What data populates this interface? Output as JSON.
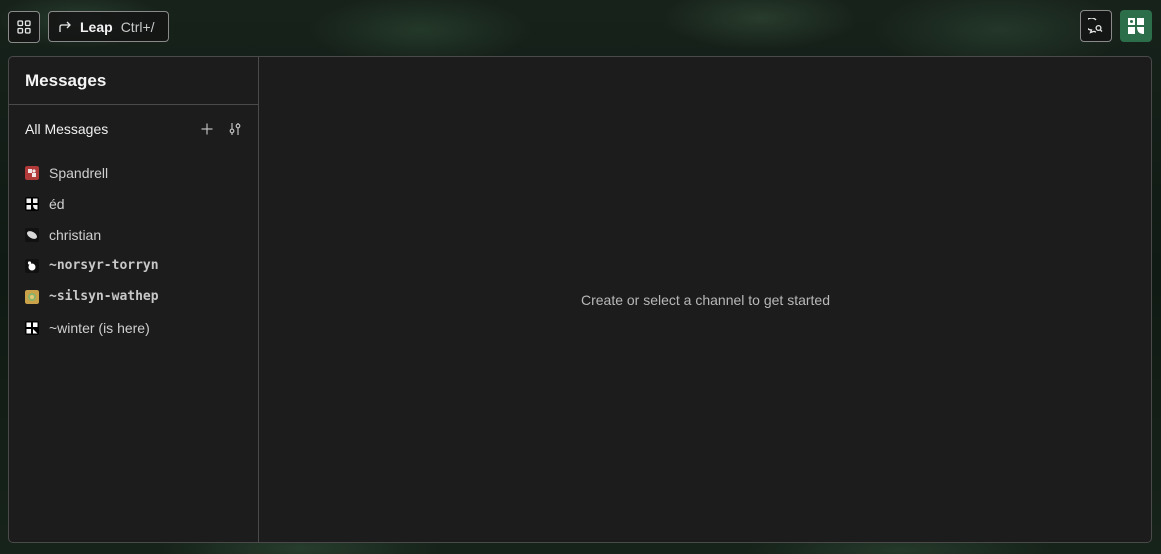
{
  "topbar": {
    "apps_icon": "grid-icon",
    "leap_label": "Leap",
    "leap_shortcut": "Ctrl+/",
    "notifications_icon": "search-chat-icon"
  },
  "sidebar": {
    "title": "Messages",
    "section_title": "All Messages",
    "channels": [
      {
        "name": "Spandrell",
        "mono": false,
        "color": "#b03a3a"
      },
      {
        "name": "éd",
        "mono": false,
        "color": "#f2f2f2"
      },
      {
        "name": "christian",
        "mono": false,
        "color": "#d8d8d8"
      },
      {
        "name": "~norsyr-torryn",
        "mono": true,
        "color": "#ffffff"
      },
      {
        "name": "~silsyn-wathep",
        "mono": true,
        "color": "#c9a24a"
      },
      {
        "name": "~winter (is here)",
        "mono": false,
        "color": "#ffffff"
      }
    ]
  },
  "main": {
    "empty_text": "Create or select a channel to get started"
  },
  "colors": {
    "accent": "#2c6e4a",
    "panel": "#1c1c1c",
    "border": "#4a4a4a"
  }
}
